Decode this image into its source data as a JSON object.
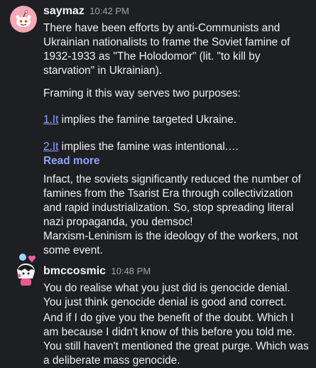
{
  "messages": [
    {
      "username": "saymaz",
      "time": "10:42 PM",
      "intro": "There have been efforts by anti-Communists and Ukrainian nationalists to frame the Soviet famine of 1932-1933 as \"The Holodomor\" (lit. \"to kill by starvation\" in Ukrainian).",
      "framing": "Framing it this way serves two purposes:",
      "point1_link": "1.It",
      "point1_text": " implies the famine targeted Ukraine.",
      "point2_link": "2.It",
      "point2_text": " implies the famine was intentional.…",
      "read_more": "Read more",
      "reply1": "Infact, the soviets significantly reduced the number of famines from the Tsarist Era through collectivization and rapid industrialization. So, stop spreading literal nazi propaganda, you demsoc!",
      "reply2": "Marxism-Leninism is the ideology of the workers, not some event."
    },
    {
      "username": "bmccosmic",
      "time": "10:48 PM",
      "line1": "You do realise what you just did is genocide denial.",
      "line2": "You just think genocide denial is good and correct.",
      "followup": "And if I do give you the benefit of the doubt. Which I am because I didn't know of this before you told me. You still haven't mentioned the great purge. Which was a deliberate mass genocide."
    }
  ]
}
